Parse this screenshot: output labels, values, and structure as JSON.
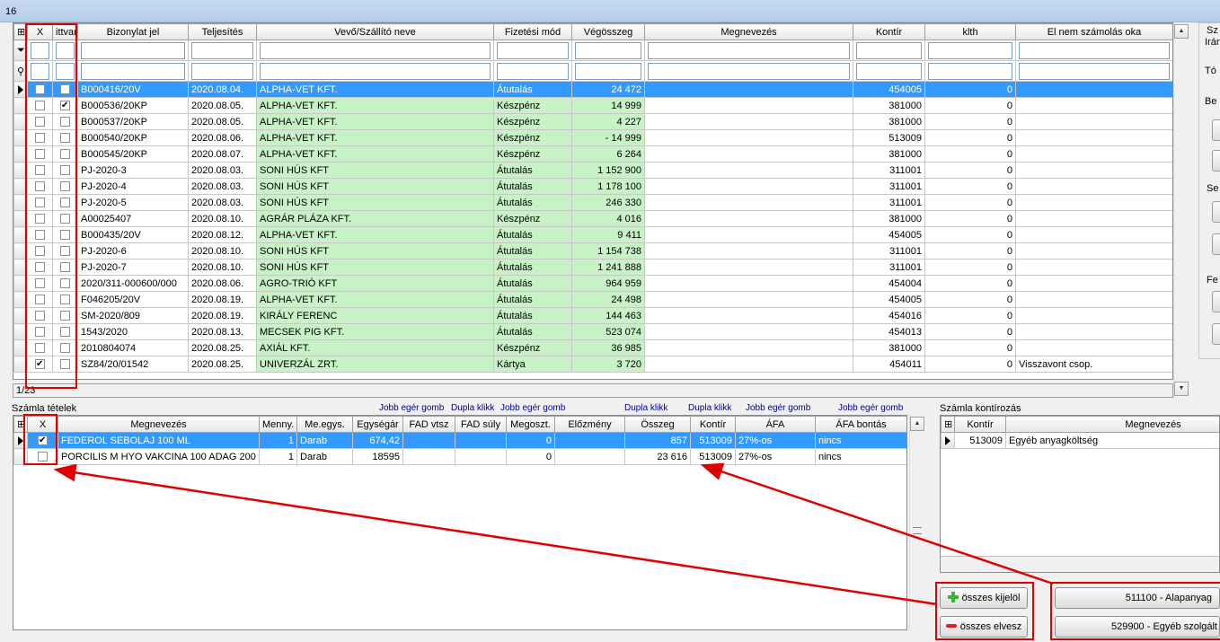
{
  "window": {
    "title": "16"
  },
  "invoices": {
    "columns": [
      "X",
      "ittvan",
      "Bizonylat jel",
      "Teljesítés",
      "Vevő/Szállító neve",
      "Fizetési mód",
      "Végösszeg",
      "Megnevezés",
      "Kontír",
      "klth",
      "El nem számolás oka"
    ],
    "rows": [
      {
        "x": false,
        "itt": false,
        "jel": "B000416/20V",
        "telj": "2020.08.04.",
        "nev": "ALPHA-VET KFT.",
        "mod": "Átutalás",
        "osszeg": "24 472",
        "megn": "",
        "kontir": "454005",
        "klth": "0",
        "ok": ""
      },
      {
        "x": false,
        "itt": true,
        "jel": "B000536/20KP",
        "telj": "2020.08.05.",
        "nev": "ALPHA-VET KFT.",
        "mod": "Készpénz",
        "osszeg": "14 999",
        "megn": "",
        "kontir": "381000",
        "klth": "0",
        "ok": ""
      },
      {
        "x": false,
        "itt": false,
        "jel": "B000537/20KP",
        "telj": "2020.08.05.",
        "nev": "ALPHA-VET KFT.",
        "mod": "Készpénz",
        "osszeg": "4 227",
        "megn": "",
        "kontir": "381000",
        "klth": "0",
        "ok": ""
      },
      {
        "x": false,
        "itt": false,
        "jel": "B000540/20KP",
        "telj": "2020.08.06.",
        "nev": "ALPHA-VET KFT.",
        "mod": "Készpénz",
        "osszeg": "- 14 999",
        "megn": "",
        "kontir": "513009",
        "klth": "0",
        "ok": ""
      },
      {
        "x": false,
        "itt": false,
        "jel": "B000545/20KP",
        "telj": "2020.08.07.",
        "nev": "ALPHA-VET KFT.",
        "mod": "Készpénz",
        "osszeg": "6 264",
        "megn": "",
        "kontir": "381000",
        "klth": "0",
        "ok": ""
      },
      {
        "x": false,
        "itt": false,
        "jel": "PJ-2020-3",
        "telj": "2020.08.03.",
        "nev": "SONI HÚS KFT",
        "mod": "Átutalás",
        "osszeg": "1 152 900",
        "megn": "",
        "kontir": "311001",
        "klth": "0",
        "ok": ""
      },
      {
        "x": false,
        "itt": false,
        "jel": "PJ-2020-4",
        "telj": "2020.08.03.",
        "nev": "SONI HÚS KFT",
        "mod": "Átutalás",
        "osszeg": "1 178 100",
        "megn": "",
        "kontir": "311001",
        "klth": "0",
        "ok": ""
      },
      {
        "x": false,
        "itt": false,
        "jel": "PJ-2020-5",
        "telj": "2020.08.03.",
        "nev": "SONI HÚS KFT",
        "mod": "Átutalás",
        "osszeg": "246 330",
        "megn": "",
        "kontir": "311001",
        "klth": "0",
        "ok": ""
      },
      {
        "x": false,
        "itt": false,
        "jel": "A00025407",
        "telj": "2020.08.10.",
        "nev": "AGRÁR PLÁZA KFT.",
        "mod": "Készpénz",
        "osszeg": "4 016",
        "megn": "",
        "kontir": "381000",
        "klth": "0",
        "ok": ""
      },
      {
        "x": false,
        "itt": false,
        "jel": "B000435/20V",
        "telj": "2020.08.12.",
        "nev": "ALPHA-VET KFT.",
        "mod": "Átutalás",
        "osszeg": "9 411",
        "megn": "",
        "kontir": "454005",
        "klth": "0",
        "ok": ""
      },
      {
        "x": false,
        "itt": false,
        "jel": "PJ-2020-6",
        "telj": "2020.08.10.",
        "nev": "SONI HÚS KFT",
        "mod": "Átutalás",
        "osszeg": "1 154 738",
        "megn": "",
        "kontir": "311001",
        "klth": "0",
        "ok": ""
      },
      {
        "x": false,
        "itt": false,
        "jel": "PJ-2020-7",
        "telj": "2020.08.10.",
        "nev": "SONI HÚS KFT",
        "mod": "Átutalás",
        "osszeg": "1 241 888",
        "megn": "",
        "kontir": "311001",
        "klth": "0",
        "ok": ""
      },
      {
        "x": false,
        "itt": false,
        "jel": "2020/311-000600/000",
        "telj": "2020.08.06.",
        "nev": "AGRO-TRIÓ KFT",
        "mod": "Átutalás",
        "osszeg": "964 959",
        "megn": "",
        "kontir": "454004",
        "klth": "0",
        "ok": ""
      },
      {
        "x": false,
        "itt": false,
        "jel": "F046205/20V",
        "telj": "2020.08.19.",
        "nev": "ALPHA-VET KFT.",
        "mod": "Átutalás",
        "osszeg": "24 498",
        "megn": "",
        "kontir": "454005",
        "klth": "0",
        "ok": ""
      },
      {
        "x": false,
        "itt": false,
        "jel": "SM-2020/809",
        "telj": "2020.08.19.",
        "nev": "KIRÁLY FERENC",
        "mod": "Átutalás",
        "osszeg": "144 463",
        "megn": "",
        "kontir": "454016",
        "klth": "0",
        "ok": ""
      },
      {
        "x": false,
        "itt": false,
        "jel": "1543/2020",
        "telj": "2020.08.13.",
        "nev": "MECSEK PIG KFT.",
        "mod": "Átutalás",
        "osszeg": "523 074",
        "megn": "",
        "kontir": "454013",
        "klth": "0",
        "ok": ""
      },
      {
        "x": false,
        "itt": false,
        "jel": "2010804074",
        "telj": "2020.08.25.",
        "nev": "AXIÁL KFT.",
        "mod": "Készpénz",
        "osszeg": "36 985",
        "megn": "",
        "kontir": "381000",
        "klth": "0",
        "ok": ""
      },
      {
        "x": true,
        "itt": false,
        "jel": "SZ84/20/01542",
        "telj": "2020.08.25.",
        "nev": "UNIVERZÁL ZRT.",
        "mod": "Kártya",
        "osszeg": "3 720",
        "megn": "",
        "kontir": "454011",
        "klth": "0",
        "ok": "Visszavont csop."
      }
    ],
    "status": "1/23"
  },
  "items": {
    "section_label": "Számla tételek",
    "hints": [
      "Jobb egér gomb",
      "Dupla klikk",
      "Jobb egér gomb",
      "Dupla klikk",
      "Dupla klikk",
      "Jobb egér gomb",
      "Jobb egér gomb"
    ],
    "columns": [
      "X",
      "Megnevezés",
      "Menny.",
      "Me.egys.",
      "Egységár",
      "FAD vtsz",
      "FAD súly",
      "Megoszt.",
      "Előzmény",
      "Összeg",
      "Kontír",
      "ÁFA",
      "ÁFA bontás"
    ],
    "rows": [
      {
        "x": true,
        "megn": "FEDEROL SEBOLAJ 100 ML",
        "menny": "1",
        "me": "Darab",
        "ar": "674,42",
        "vtsz": "",
        "suly": "",
        "megoszt": "0",
        "elozmeny": "",
        "osszeg": "857",
        "kontir": "513009",
        "afa": "27%-os",
        "bontas": "nincs"
      },
      {
        "x": false,
        "megn": "PORCILIS M HYO VAKCINA 100 ADAG 200",
        "menny": "1",
        "me": "Darab",
        "ar": "18595",
        "vtsz": "",
        "suly": "",
        "megoszt": "0",
        "elozmeny": "",
        "osszeg": "23 616",
        "kontir": "513009",
        "afa": "27%-os",
        "bontas": "nincs"
      }
    ]
  },
  "kontirozas": {
    "section_label": "Számla kontírozás",
    "columns": [
      "Kontír",
      "Megnevezés"
    ],
    "rows": [
      {
        "kontir": "513009",
        "megn": "Egyéb anyagköltség"
      }
    ]
  },
  "buttons": {
    "select_all": "összes kijelöl",
    "deselect_all": "összes elvesz",
    "kontir1": "511100 - Alapanyag",
    "kontir2": "529900 - Egyéb szolgált"
  },
  "right_panel": {
    "frag1": "Sz",
    "frag2": "Irán",
    "frag3": "Tó",
    "frag4": "Be",
    "frag5": "Se",
    "frag6": "Fe"
  },
  "colors": {
    "selection": "#3399ff",
    "green_cell": "#c6f2c6",
    "annotation": "#e00000",
    "hint_text": "#00008b"
  }
}
